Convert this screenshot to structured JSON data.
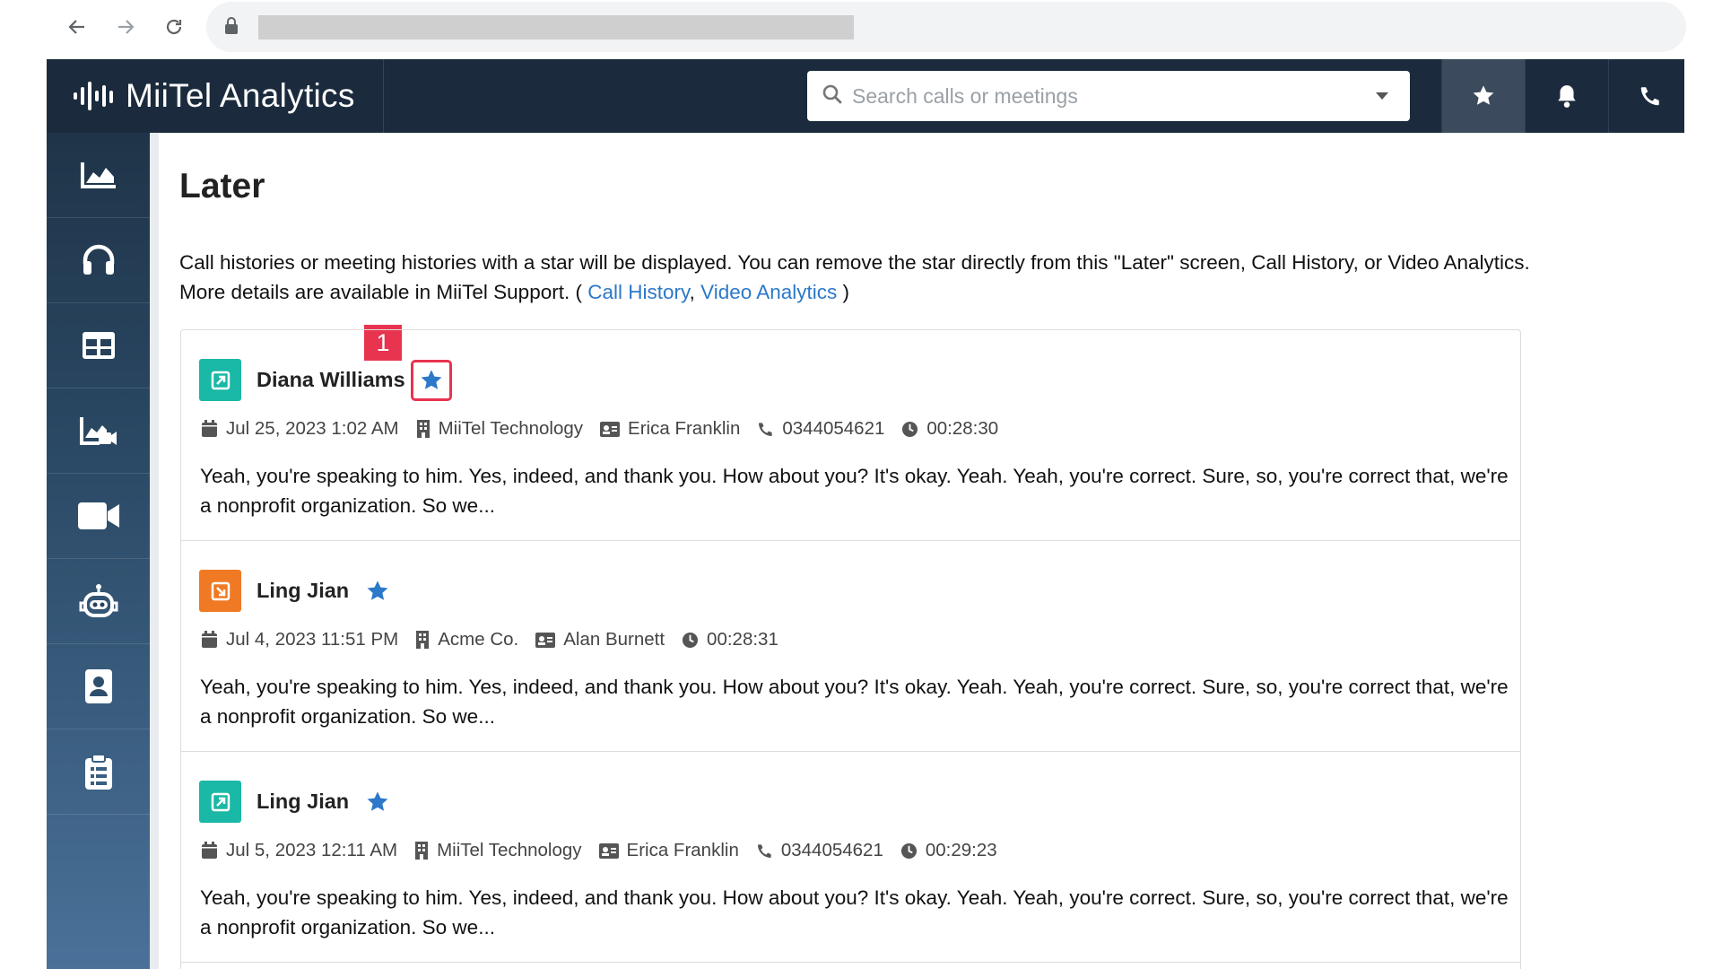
{
  "app": {
    "title": "MiiTel Analytics"
  },
  "search": {
    "placeholder": "Search calls or meetings"
  },
  "header_buttons": [
    {
      "name": "later-star-icon",
      "active": true
    },
    {
      "name": "bell-icon",
      "active": false
    },
    {
      "name": "phone-icon",
      "active": false
    }
  ],
  "sidebar": {
    "items": [
      {
        "icon": "area-chart-icon"
      },
      {
        "icon": "headset-icon"
      },
      {
        "icon": "table-grid-icon"
      },
      {
        "icon": "video-analytics-icon"
      },
      {
        "icon": "video-camera-icon"
      },
      {
        "icon": "robot-icon"
      },
      {
        "icon": "contact-book-icon"
      },
      {
        "icon": "clipboard-icon"
      }
    ]
  },
  "page": {
    "title": "Later",
    "description_line1": "Call histories or meeting histories with a star will be displayed. You can remove the star directly from this \"Later\" screen, Call History, or Video Analytics.",
    "description_line2_prefix": "More details are available in MiiTel Support. ( ",
    "link_call_history": "Call History",
    "comma": ", ",
    "link_video_analytics": "Video Analytics",
    "description_line2_suffix": " )"
  },
  "annotation": {
    "badge": "1"
  },
  "colors": {
    "accent_blue": "#2c78c9",
    "outgoing": "#1ab8a6",
    "incoming": "#f07a24",
    "highlight": "#e8344f",
    "header": "#1b2b3d"
  },
  "cards": [
    {
      "direction": "outgoing",
      "name": "Diana Williams",
      "date": "Jul 25, 2023 1:02 AM",
      "company": "MiiTel Technology",
      "user": "Erica Franklin",
      "phone": "0344054621",
      "duration": "00:28:30",
      "snippet": "Yeah, you're speaking to him. Yes, indeed, and thank you. How about you? It's okay. Yeah. Yeah, you're correct. Sure, so, you're correct that, we're a nonprofit organization. So we..."
    },
    {
      "direction": "incoming",
      "name": "Ling Jian",
      "date": "Jul 4, 2023 11:51 PM",
      "company": "Acme Co.",
      "user": "Alan Burnett",
      "phone": "",
      "duration": "00:28:31",
      "snippet": "Yeah, you're speaking to him. Yes, indeed, and thank you. How about you? It's okay. Yeah. Yeah, you're correct. Sure, so, you're correct that, we're a nonprofit organization. So we..."
    },
    {
      "direction": "outgoing",
      "name": "Ling Jian",
      "date": "Jul 5, 2023 12:11 AM",
      "company": "MiiTel Technology",
      "user": "Erica Franklin",
      "phone": "0344054621",
      "duration": "00:29:23",
      "snippet": "Yeah, you're speaking to him. Yes, indeed, and thank you. How about you? It's okay. Yeah. Yeah, you're correct. Sure, so, you're correct that, we're a nonprofit organization. So we..."
    }
  ]
}
